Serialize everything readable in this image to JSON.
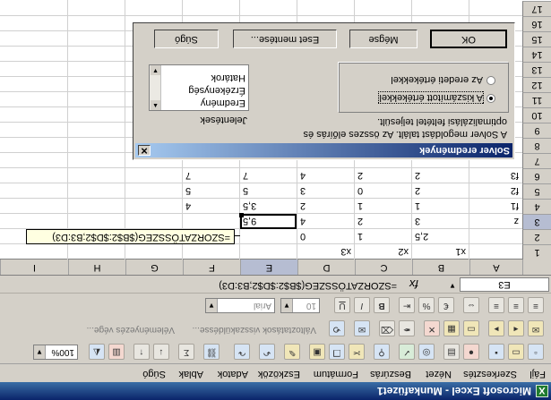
{
  "window": {
    "title": "Microsoft Excel - Munkafüzet1",
    "app_icon": "excel-icon"
  },
  "menu": [
    "Fájl",
    "Szerkesztés",
    "Nézet",
    "Beszúrás",
    "Formátum",
    "Eszközök",
    "Adatok",
    "Ablak",
    "Súgó"
  ],
  "toolbar_standard": {
    "zoom": "100%"
  },
  "toolbar_review": {
    "track_changes_label": "Változtatások visszaküldésse...",
    "end_review_label": "Véleményezés vége..."
  },
  "toolbar_format": {
    "font": "Arial",
    "size": "10"
  },
  "formula_bar": {
    "name_box": "E3",
    "fx": "fx",
    "formula": "=SZORZATÖSSZEG($B$2:$D$2;B3:D3)"
  },
  "columns": [
    "A",
    "B",
    "C",
    "D",
    "E",
    "F",
    "G",
    "H",
    "I"
  ],
  "rows": [
    "1",
    "2",
    "3",
    "4",
    "5",
    "6",
    "7",
    "8",
    "9",
    "10",
    "11",
    "12",
    "13",
    "14",
    "15",
    "16",
    "17"
  ],
  "cells": {
    "B1": "x1",
    "C1": "x2",
    "D1": "x3",
    "B2": "2,5",
    "C2": "1",
    "D2": "0",
    "A3": "z",
    "B3": "3",
    "C3": "2",
    "D3": "4",
    "E3": "9,5",
    "A4": "f1",
    "B4": "1",
    "C4": "1",
    "D4": "2",
    "E4": "3,5",
    "F4": "4",
    "A5": "f2",
    "B5": "2",
    "C5": "0",
    "D5": "3",
    "E5": "5",
    "F5": "5",
    "A6": "f3",
    "B6": "2",
    "C6": "2",
    "D6": "4",
    "E6": "7",
    "F6": "7"
  },
  "tooltip": "=SZORZATÖSSZEG($B$2:$D$2;B3:D3)",
  "dialog": {
    "title": "Solver eredmények",
    "message_line1": "A Solver megoldást talált. Az összes előírás és",
    "message_line2": "optimalizálási feltétel teljesült.",
    "option_keep": "A kiszámított értékekkel",
    "option_restore": "Az eredeti értékekkel",
    "reports_label": "Jelentések",
    "reports": [
      "Eredmény",
      "Érzékenység",
      "Határok"
    ],
    "btn_ok": "OK",
    "btn_cancel": "Mégse",
    "btn_save": "Eset mentése...",
    "btn_help": "Súgó"
  }
}
